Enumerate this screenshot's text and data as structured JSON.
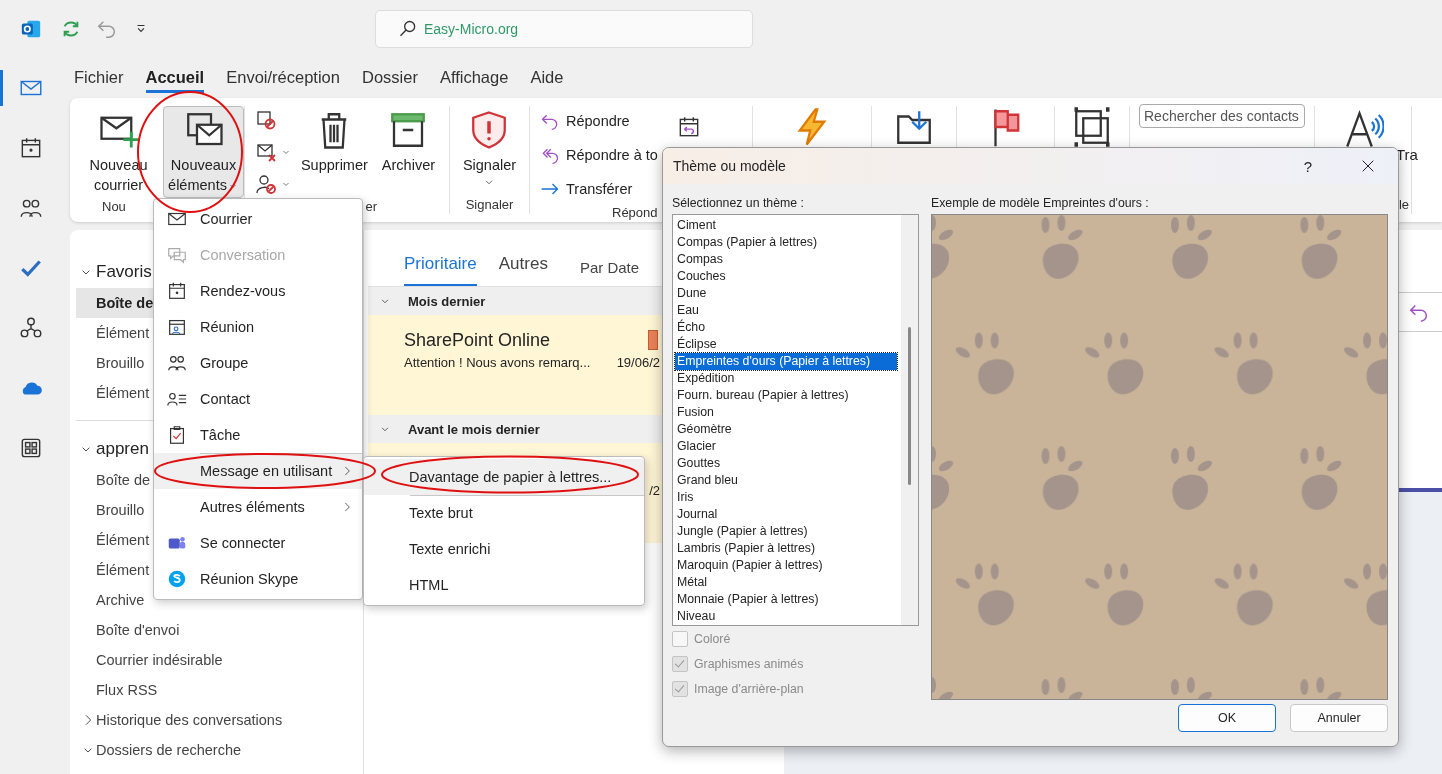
{
  "app_bar": {
    "search": {
      "value": "Easy-Micro.org"
    }
  },
  "nav_rail": [
    {
      "selected": true
    },
    {
      "selected": false
    },
    {
      "selected": false
    },
    {
      "selected": false
    },
    {
      "selected": false
    },
    {
      "selected": false
    },
    {
      "selected": false
    }
  ],
  "ribbon_tabs": [
    {
      "label": "Fichier",
      "selected": false
    },
    {
      "label": "Accueil",
      "selected": true
    },
    {
      "label": "Envoi/réception",
      "selected": false
    },
    {
      "label": "Dossier",
      "selected": false
    },
    {
      "label": "Affichage",
      "selected": false
    },
    {
      "label": "Aide",
      "selected": false
    }
  ],
  "ribbon": {
    "groups": [
      {
        "label": "Nou",
        "items": [
          {
            "kind": "large",
            "label": "Nouveau courrier",
            "pressed": false,
            "dropdown": false
          },
          {
            "kind": "large",
            "label": "Nouveaux éléments",
            "pressed": true,
            "dropdown": true
          }
        ]
      },
      {
        "label": "er",
        "items": [
          {
            "kind": "icon-stack",
            "buttons": [
              {
                "dropdown": false
              },
              {
                "dropdown": true
              },
              {
                "dropdown": true
              }
            ]
          },
          {
            "kind": "large",
            "label": "Supprimer",
            "pressed": false,
            "dropdown": false
          },
          {
            "kind": "large",
            "label": "Archiver",
            "pressed": false,
            "dropdown": false
          }
        ]
      },
      {
        "label": "Signaler",
        "items": [
          {
            "kind": "large",
            "label": "Signaler",
            "pressed": false,
            "dropdown": true
          }
        ]
      },
      {
        "label": "Répond",
        "items": [
          {
            "kind": "list",
            "buttons": [
              {
                "label": "Répondre"
              },
              {
                "label": "Répondre à to"
              },
              {
                "label": "Transférer"
              }
            ]
          },
          {
            "kind": "icon"
          }
        ]
      },
      {
        "items": [
          {
            "kind": "icon"
          }
        ]
      },
      {
        "items": [
          {
            "kind": "icon"
          }
        ]
      },
      {
        "items": [
          {
            "kind": "icon"
          }
        ]
      },
      {
        "items": [
          {
            "kind": "icon"
          }
        ]
      },
      {
        "items": [
          {
            "kind": "field",
            "placeholder": "Rechercher des contacts"
          }
        ]
      },
      {
        "label": "le",
        "items": [
          {
            "kind": "icon"
          }
        ]
      },
      {
        "items": [
          {
            "kind": "text",
            "label": "Tra"
          }
        ]
      }
    ]
  },
  "folders": [
    {
      "label": "Favoris",
      "expanded": true,
      "children": [
        {
          "label": "Boîte de",
          "selected": true
        },
        {
          "label": "Élément",
          "selected": false
        },
        {
          "label": "Brouillo",
          "selected": false
        },
        {
          "label": "Élément",
          "selected": false
        }
      ]
    },
    {
      "label": "appren",
      "expanded": true,
      "children": [
        {
          "label": "Boîte de",
          "selected": false
        },
        {
          "label": "Brouillo",
          "selected": false
        },
        {
          "label": "Élément",
          "selected": false
        },
        {
          "label": "Élément",
          "selected": false
        },
        {
          "label": "Archive",
          "selected": false
        },
        {
          "label": "Boîte d'envoi",
          "selected": false
        },
        {
          "label": "Courrier indésirable",
          "selected": false
        },
        {
          "label": "Flux RSS",
          "selected": false
        },
        {
          "label": "Historique des conversations",
          "selected": false,
          "expanded": false
        },
        {
          "label": "Dossiers de recherche",
          "selected": false,
          "expanded": true
        }
      ]
    }
  ],
  "message_list": {
    "tabs": [
      {
        "label": "Prioritaire",
        "selected": true
      },
      {
        "label": "Autres",
        "selected": false
      }
    ],
    "sort": "Par Date",
    "groups": [
      {
        "label": "Mois dernier",
        "expanded": true,
        "messages": [
          {
            "sender": "SharePoint Online",
            "preview": "Attention ! Nous avons remarq...",
            "date": "19/06/2",
            "color": "#e8825a"
          }
        ]
      },
      {
        "label": "Avant le mois dernier",
        "expanded": true,
        "messages": [
          {
            "date": "/2"
          }
        ]
      }
    ]
  },
  "new_items_menu": [
    {
      "label": "Courrier",
      "disabled": false,
      "submenu": false,
      "selected": false,
      "separator_before": false
    },
    {
      "label": "Conversation",
      "disabled": true,
      "submenu": false,
      "selected": false,
      "separator_before": false
    },
    {
      "label": "Rendez-vous",
      "disabled": false,
      "submenu": false,
      "selected": false,
      "separator_before": false
    },
    {
      "label": "Réunion",
      "disabled": false,
      "submenu": false,
      "selected": false,
      "separator_before": false
    },
    {
      "label": "Groupe",
      "disabled": false,
      "submenu": false,
      "selected": false,
      "separator_before": false
    },
    {
      "label": "Contact",
      "disabled": false,
      "submenu": false,
      "selected": false,
      "separator_before": false
    },
    {
      "label": "Tâche",
      "disabled": false,
      "submenu": false,
      "selected": false,
      "separator_before": false
    },
    {
      "label": "Message en utilisant",
      "disabled": false,
      "submenu": true,
      "selected": true,
      "separator_before": true
    },
    {
      "label": "Autres éléments",
      "disabled": false,
      "submenu": true,
      "selected": false,
      "separator_before": false
    },
    {
      "label": "Se connecter",
      "disabled": false,
      "submenu": false,
      "selected": false,
      "separator_before": false
    },
    {
      "label": "Réunion Skype",
      "disabled": false,
      "submenu": false,
      "selected": false,
      "separator_before": false
    }
  ],
  "submenu": [
    {
      "label": "Davantage de papier à lettres...",
      "selected": true,
      "separator_before": false
    },
    {
      "label": "Texte brut",
      "selected": false,
      "separator_before": true
    },
    {
      "label": "Texte enrichi",
      "selected": false,
      "separator_before": false
    },
    {
      "label": "HTML",
      "selected": false,
      "separator_before": false
    }
  ],
  "dialog": {
    "title": "Thème ou modèle",
    "help": "?",
    "list_label": "Sélectionnez un thème :",
    "preview_label": "Exemple de modèle Empreintes d'ours :",
    "themes": [
      {
        "label": "Ciment",
        "selected": false
      },
      {
        "label": "Compas (Papier à lettres)",
        "selected": false
      },
      {
        "label": "Compas",
        "selected": false
      },
      {
        "label": "Couches",
        "selected": false
      },
      {
        "label": "Dune",
        "selected": false
      },
      {
        "label": "Eau",
        "selected": false
      },
      {
        "label": "Écho",
        "selected": false
      },
      {
        "label": "Éclipse",
        "selected": false
      },
      {
        "label": "Empreintes d'ours (Papier à lettres)",
        "selected": true
      },
      {
        "label": "Expédition",
        "selected": false
      },
      {
        "label": "Fourn. bureau (Papier à lettres)",
        "selected": false
      },
      {
        "label": "Fusion",
        "selected": false
      },
      {
        "label": "Géomètre",
        "selected": false
      },
      {
        "label": "Glacier",
        "selected": false
      },
      {
        "label": "Gouttes",
        "selected": false
      },
      {
        "label": "Grand bleu",
        "selected": false
      },
      {
        "label": "Iris",
        "selected": false
      },
      {
        "label": "Journal",
        "selected": false
      },
      {
        "label": "Jungle (Papier à lettres)",
        "selected": false
      },
      {
        "label": "Lambris (Papier à lettres)",
        "selected": false
      },
      {
        "label": "Maroquin (Papier à lettres)",
        "selected": false
      },
      {
        "label": "Métal",
        "selected": false
      },
      {
        "label": "Monnaie (Papier à lettres)",
        "selected": false
      },
      {
        "label": "Niveau",
        "selected": false
      }
    ],
    "options": [
      {
        "label": "Coloré",
        "checked": false,
        "disabled": true
      },
      {
        "label": "Graphismes animés",
        "checked": true,
        "disabled": true
      },
      {
        "label": "Image d'arrière-plan",
        "checked": true,
        "disabled": true
      }
    ],
    "buttons": [
      {
        "label": "OK",
        "default": true
      },
      {
        "label": "Annuler",
        "default": false
      }
    ]
  }
}
